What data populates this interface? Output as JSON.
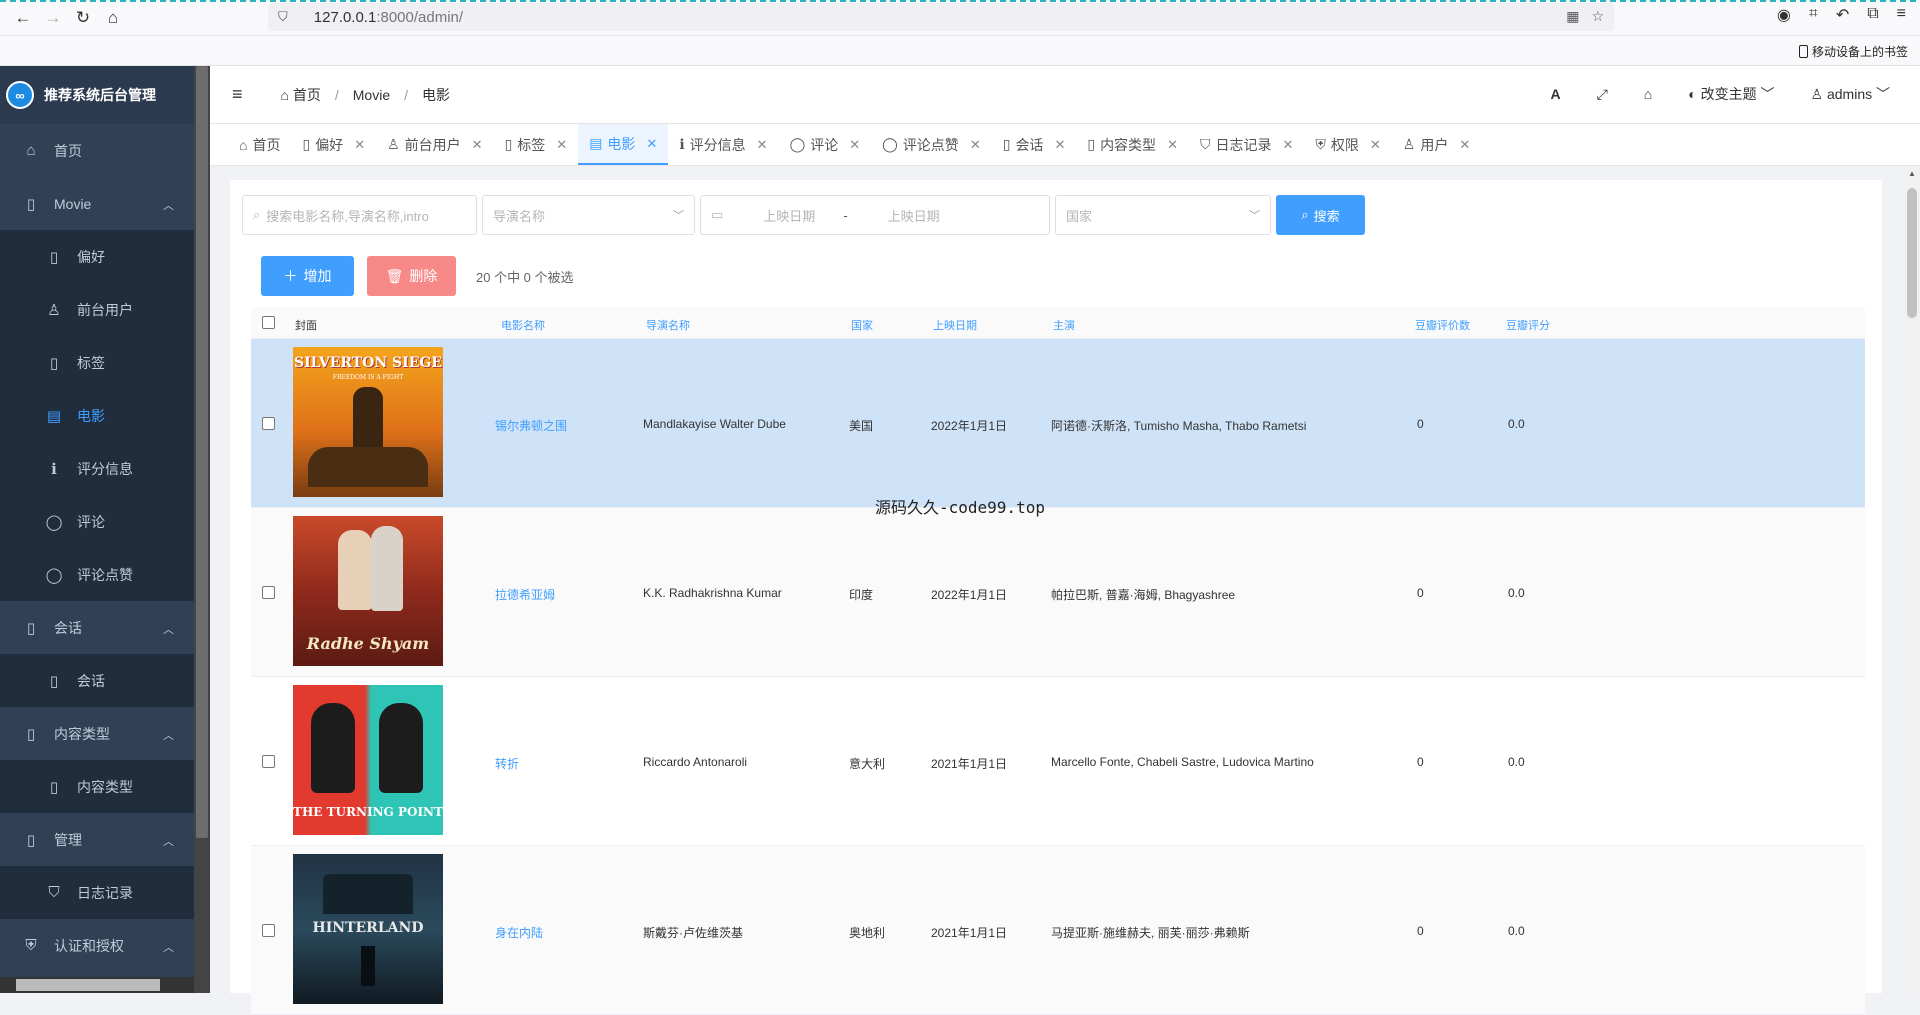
{
  "browser": {
    "url_host": "127.0.0.1",
    "url_rest": ":8000/admin/",
    "mobile_bookmarks": "移动设备上的书签"
  },
  "sidebar": {
    "app_title": "推荐系统后台管理",
    "items": [
      {
        "label": "首页",
        "icon": "home-icon"
      },
      {
        "label": "Movie",
        "icon": "document-icon"
      },
      {
        "label": "偏好",
        "icon": "document-icon"
      },
      {
        "label": "前台用户",
        "icon": "user-icon"
      },
      {
        "label": "标签",
        "icon": "document-icon"
      },
      {
        "label": "电影",
        "icon": "film-icon"
      },
      {
        "label": "评分信息",
        "icon": "info-icon"
      },
      {
        "label": "评论",
        "icon": "comment-icon"
      },
      {
        "label": "评论点赞",
        "icon": "comment-icon"
      },
      {
        "label": "会话",
        "icon": "document-icon"
      },
      {
        "label": "会话",
        "icon": "document-icon"
      },
      {
        "label": "内容类型",
        "icon": "document-icon"
      },
      {
        "label": "内容类型",
        "icon": "document-icon"
      },
      {
        "label": "管理",
        "icon": "document-icon"
      },
      {
        "label": "日志记录",
        "icon": "bookmark-icon"
      },
      {
        "label": "认证和授权",
        "icon": "shield-icon"
      }
    ]
  },
  "header": {
    "breadcrumb": [
      "首页",
      "Movie",
      "电影"
    ],
    "theme_label": "改变主题",
    "user": "admins"
  },
  "tabs": [
    {
      "label": "首页"
    },
    {
      "label": "偏好"
    },
    {
      "label": "前台用户"
    },
    {
      "label": "标签"
    },
    {
      "label": "电影"
    },
    {
      "label": "评分信息"
    },
    {
      "label": "评论"
    },
    {
      "label": "评论点赞"
    },
    {
      "label": "会话"
    },
    {
      "label": "内容类型"
    },
    {
      "label": "日志记录"
    },
    {
      "label": "权限"
    },
    {
      "label": "用户"
    }
  ],
  "filters": {
    "search_placeholder": "搜索电影名称,导演名称,intro",
    "director_placeholder": "导演名称",
    "date_start": "上映日期",
    "date_sep": "-",
    "date_end": "上映日期",
    "country_placeholder": "国家",
    "search_button": "搜索"
  },
  "actions": {
    "add": "增加",
    "delete": "删除",
    "selection": "20 个中 0 个被选"
  },
  "table": {
    "columns": [
      "封面",
      "电影名称",
      "导演名称",
      "国家",
      "上映日期",
      "主演",
      "豆瓣评价数",
      "豆瓣评分"
    ],
    "rows": [
      {
        "poster_title": "SILVERTON SIEGE",
        "poster_sub": "FREEDOM IS A FIGHT",
        "name": "锡尔弗顿之围",
        "director": "Mandlakayise Walter Dube",
        "country": "美国",
        "date": "2022年1月1日",
        "cast": "阿诺德·沃斯洛, Tumisho Masha, Thabo Rametsi",
        "votes": "0",
        "score": "0.0"
      },
      {
        "poster_title": "Radhe Shyam",
        "poster_sub": "",
        "name": "拉德希亚姆",
        "director": "K.K. Radhakrishna Kumar",
        "country": "印度",
        "date": "2022年1月1日",
        "cast": "帕拉巴斯, 普嘉·海姆, Bhagyashree",
        "votes": "0",
        "score": "0.0"
      },
      {
        "poster_title": "THE TURNING POINT",
        "poster_sub": "",
        "name": "转折",
        "director": "Riccardo Antonaroli",
        "country": "意大利",
        "date": "2021年1月1日",
        "cast": "Marcello Fonte, Chabeli Sastre, Ludovica Martino",
        "votes": "0",
        "score": "0.0"
      },
      {
        "poster_title": "HINTERLAND",
        "poster_sub": "",
        "name": "身在内陆",
        "director": "斯戴芬·卢佐维茨基",
        "country": "奥地利",
        "date": "2021年1月1日",
        "cast": "马提亚斯·施维赫夫, 丽芙·丽莎·弗赖斯",
        "votes": "0",
        "score": "0.0"
      }
    ]
  },
  "overlay_text": "源码久久-code99.top"
}
